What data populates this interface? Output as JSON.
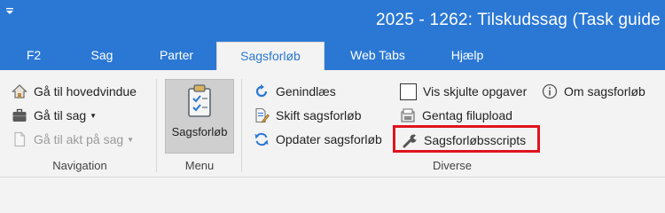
{
  "window": {
    "title": "2025 - 1262: Tilskudssag (Task guide"
  },
  "tabs": [
    {
      "label": "F2",
      "active": false
    },
    {
      "label": "Sag",
      "active": false
    },
    {
      "label": "Parter",
      "active": false
    },
    {
      "label": "Sagsforløb",
      "active": true
    },
    {
      "label": "Web Tabs",
      "active": false
    },
    {
      "label": "Hjælp",
      "active": false
    }
  ],
  "groups": {
    "navigation": {
      "label": "Navigation",
      "items": [
        {
          "label": "Gå til hovedvindue",
          "icon": "home-icon",
          "enabled": true
        },
        {
          "label": "Gå til sag",
          "icon": "briefcase-icon",
          "enabled": true
        },
        {
          "label": "Gå til akt på sag",
          "icon": "document-icon",
          "enabled": false
        }
      ]
    },
    "menu": {
      "label": "Menu",
      "button_label": "Sagsforløb",
      "icon": "clipboard-check-icon"
    },
    "diverse": {
      "label": "Diverse",
      "items": [
        {
          "label": "Genindlæs",
          "icon": "reload-icon"
        },
        {
          "label": "Skift sagsforløb",
          "icon": "edit-document-icon"
        },
        {
          "label": "Opdater sagsforløb",
          "icon": "refresh-icon"
        },
        {
          "label": "Vis skjulte opgaver",
          "icon": "checkbox-icon",
          "checked": false
        },
        {
          "label": "Gentag filupload",
          "icon": "upload-icon"
        },
        {
          "label": "Sagsforløbsscripts",
          "icon": "wrench-icon"
        },
        {
          "label": "Om sagsforløb",
          "icon": "info-icon"
        }
      ]
    }
  },
  "colors": {
    "titlebar": "#2b78d4",
    "highlight": "#e0141e"
  }
}
